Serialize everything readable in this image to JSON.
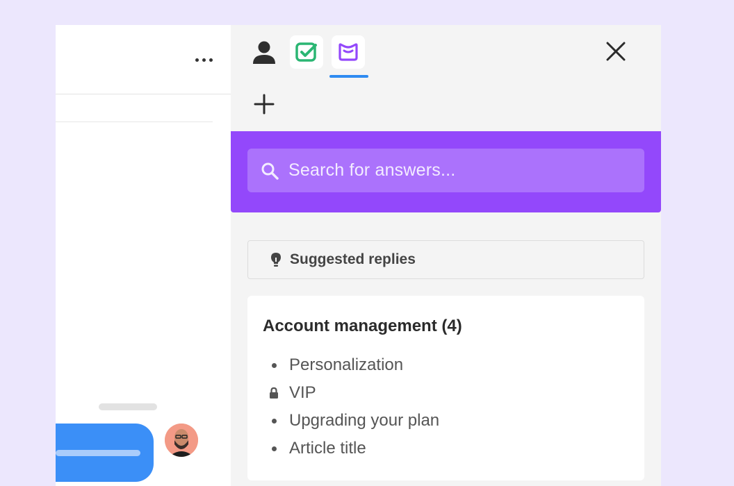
{
  "colors": {
    "background": "#ece7fd",
    "search_band": "#9348fb",
    "search_box": "#ab72fc",
    "active_tab_underline": "#2f8bf1",
    "check_app": "#2bb673",
    "book_app": "#9348fb",
    "bubble": "#3b8ff7"
  },
  "conversation": {
    "more_icon": "more-horizontal-icon"
  },
  "tabs": [
    {
      "icon": "user-icon",
      "active": false
    },
    {
      "icon": "check-app-icon",
      "active": false
    },
    {
      "icon": "knowledge-book-icon",
      "active": true
    }
  ],
  "search": {
    "placeholder": "Search for answers...",
    "icon": "search-icon"
  },
  "suggested": {
    "label": "Suggested replies",
    "icon": "lightbulb-icon"
  },
  "articles": {
    "title": "Account management (4)",
    "items": [
      {
        "label": "Personalization",
        "locked": false
      },
      {
        "label": "VIP",
        "locked": true
      },
      {
        "label": "Upgrading your plan",
        "locked": false
      },
      {
        "label": "Article title",
        "locked": false
      }
    ]
  }
}
